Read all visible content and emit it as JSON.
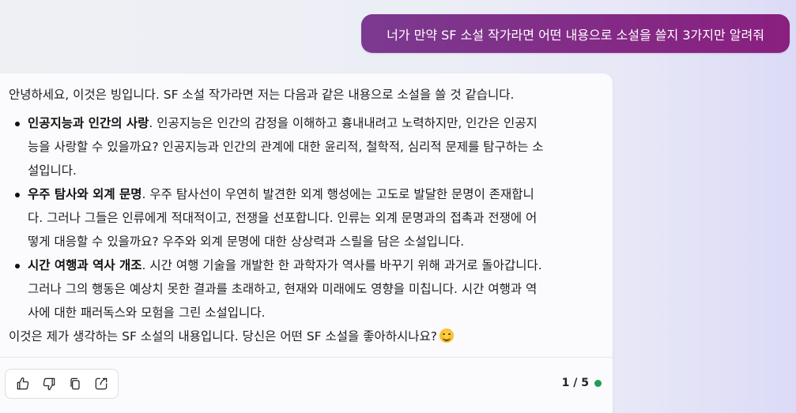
{
  "user_message": {
    "text": "너가 만약 SF 소설 작가라면 어떤 내용으로 소설을 쓸지 3가지만 알려줘"
  },
  "response": {
    "intro": "안녕하세요, 이것은 빙입니다. SF 소설 작가라면 저는 다음과 같은 내용으로 소설을 쓸 것 같습니다.",
    "items": [
      {
        "title": "인공지능과 인간의 사랑",
        "line1": ". 인공지능은 인간의 감정을 이해하고 흉내내려고 노력하지만, 인간은 인공지",
        "line2": "능을 사랑할 수 있을까요? 인공지능과 인간의 관계에 대한 윤리적, 철학적, 심리적 문제를 탐구하는 소",
        "line3": "설입니다."
      },
      {
        "title": "우주 탐사와 외계 문명",
        "line1": ". 우주 탐사선이 우연히 발견한 외계 행성에는 고도로 발달한 문명이 존재합니",
        "line2": "다. 그러나 그들은 인류에게 적대적이고, 전쟁을 선포합니다. 인류는 외계 문명과의 접촉과 전쟁에 어",
        "line3": "떻게 대응할 수 있을까요? 우주와 외계 문명에 대한 상상력과 스릴을 담은 소설입니다."
      },
      {
        "title": "시간 여행과 역사 개조",
        "line1": ". 시간 여행 기술을 개발한 한 과학자가 역사를 바꾸기 위해 과거로 돌아갑니다.",
        "line2": "그러나 그의 행동은 예상치 못한 결과를 초래하고, 현재와 미래에도 영향을 미칩니다. 시간 여행과 역",
        "line3": "사에 대한 패러독스와 모험을 그린 소설입니다."
      }
    ],
    "closing": "이것은 제가 생각하는 SF 소설의 내용입니다. 당신은 어떤 SF 소설을 좋아하시나요?",
    "closing_emoji": "smiling-face-icon"
  },
  "actions": {
    "icons": [
      "thumbs-up-icon",
      "thumbs-down-icon",
      "copy-icon",
      "share-icon"
    ]
  },
  "pagination": {
    "label": "1 / 5",
    "status_color": "#1f9d55"
  },
  "colors": {
    "user_bubble_start": "#7b3a8f",
    "user_bubble_end": "#8a1f7f"
  }
}
